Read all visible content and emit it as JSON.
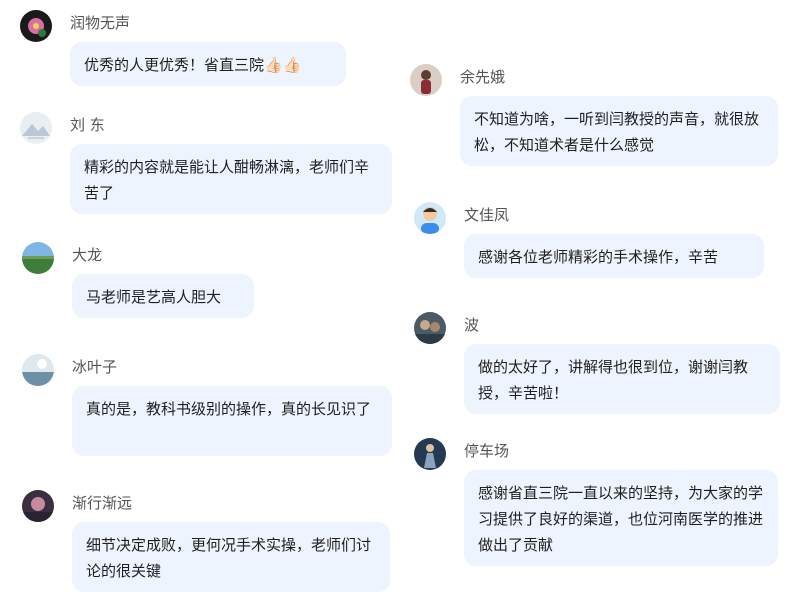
{
  "comments": [
    {
      "name": "润物无声",
      "text": "优秀的人更优秀！省直三院",
      "emoji": "👍🏻👍🏻",
      "avatar": "flower-avatar"
    },
    {
      "name": "刘 东",
      "text": "精彩的内容就是能让人酣畅淋漓，老师们辛苦了",
      "avatar": "mountain-avatar"
    },
    {
      "name": "大龙",
      "text": "马老师是艺高人胆大",
      "avatar": "field-avatar"
    },
    {
      "name": "冰叶子",
      "text": "真的是，教科书级别的操作，真的长见识了",
      "avatar": "snow-avatar"
    },
    {
      "name": "渐行渐远",
      "text": "细节决定成败，更何况手术实操，老师们讨论的很关键",
      "avatar": "dusk-avatar"
    },
    {
      "name": "余先娥",
      "text": "不知道为啥，一听到闫教授的声音，就很放松，不知道术者是什么感觉",
      "avatar": "person-avatar"
    },
    {
      "name": "文佳凤",
      "text": "感谢各位老师精彩的手术操作，辛苦",
      "avatar": "cartoon-avatar"
    },
    {
      "name": "波",
      "text": "做的太好了，讲解得也很到位，谢谢闫教授，辛苦啦！",
      "avatar": "group-avatar"
    },
    {
      "name": "停车场",
      "text": "感谢省直三院一直以来的坚持，为大家的学习提供了良好的渠道，也位河南医学的推进做出了贡献",
      "avatar": "figure-avatar"
    }
  ]
}
